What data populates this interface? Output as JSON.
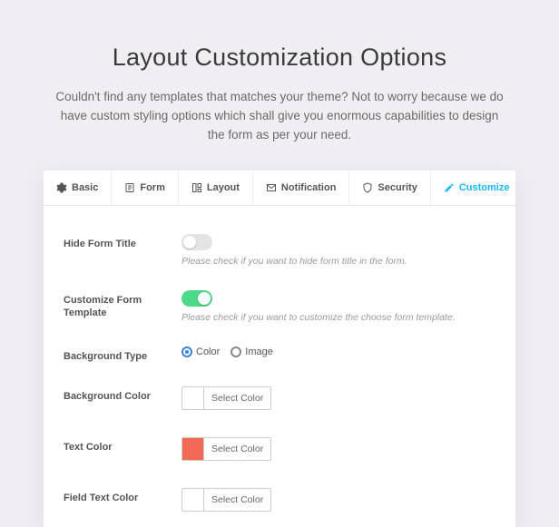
{
  "hero": {
    "title": "Layout Customization Options",
    "subtitle": "Couldn't find any templates that matches your theme? Not to worry because we do have custom styling options which shall give you enormous capabilities to design the form as per your need."
  },
  "tabs": {
    "basic": "Basic",
    "form": "Form",
    "layout": "Layout",
    "notification": "Notification",
    "security": "Security",
    "customize": "Customize"
  },
  "fields": {
    "hideFormTitle": {
      "label": "Hide Form Title",
      "help": "Please check if you want to hide form title in the form."
    },
    "customizeTemplate": {
      "label": "Customize Form Template",
      "help": "Please check if you want to customize the choose form template."
    },
    "backgroundType": {
      "label": "Background Type",
      "optColor": "Color",
      "optImage": "Image"
    },
    "backgroundColor": {
      "label": "Background Color",
      "button": "Select Color"
    },
    "textColor": {
      "label": "Text Color",
      "button": "Select Color"
    },
    "fieldTextColor": {
      "label": "Field Text Color",
      "button": "Select Color"
    }
  }
}
